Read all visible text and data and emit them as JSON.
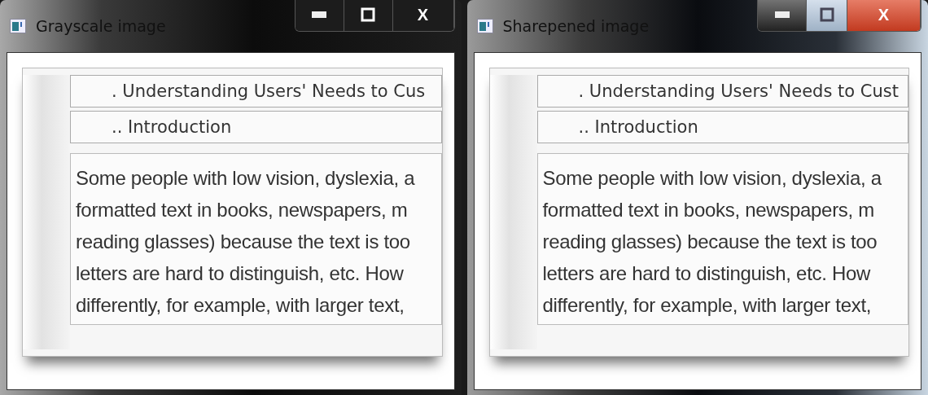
{
  "windows": [
    {
      "title": "Grayscale image",
      "active": false,
      "close_label": "X",
      "document": {
        "headings": [
          ". Understanding Users' Needs to Cus",
          ".. Introduction"
        ],
        "body_lines": [
          "Some people with low vision, dyslexia, a",
          "formatted text in books, newspapers, m",
          "reading glasses) because the text is too",
          "letters are hard to distinguish, etc. How",
          "differently, for example, with larger text,"
        ]
      }
    },
    {
      "title": "Sharepened image",
      "active": true,
      "close_label": "X",
      "document": {
        "headings": [
          ". Understanding Users' Needs to Cust",
          ".. Introduction"
        ],
        "body_lines": [
          "Some people with low vision, dyslexia, a",
          "formatted text in books, newspapers, m",
          "reading glasses) because the text is too",
          "letters are hard to distinguish, etc. How",
          "differently, for example, with larger text,"
        ]
      }
    }
  ]
}
